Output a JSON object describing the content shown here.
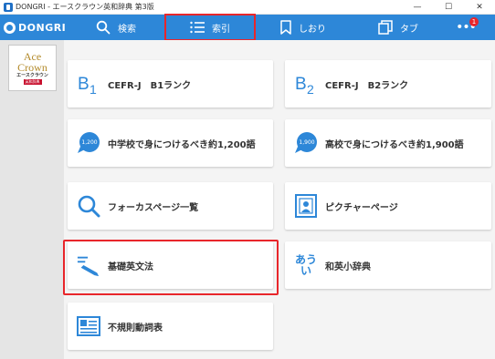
{
  "window": {
    "title": "DONGRI - エースクラウン英和辞典 第3版",
    "controls": [
      "—",
      "☐",
      "✕"
    ]
  },
  "toolbar": {
    "logo": "DONGRI",
    "tabs": [
      {
        "label": "検索",
        "icon": "search-icon"
      },
      {
        "label": "索引",
        "icon": "list-icon"
      },
      {
        "label": "しおり",
        "icon": "bookmark-icon"
      },
      {
        "label": "タブ",
        "icon": "tabs-icon"
      }
    ],
    "more_badge": "1",
    "accent_color": "#2d87d8",
    "highlight_color": "#e8262b"
  },
  "sidebar": {
    "book": {
      "line1": "Ace",
      "line2": "Crown",
      "line3": "エースクラウン",
      "line4": "英和辞典"
    }
  },
  "cards": [
    {
      "label": "CEFR-J　B1ランク",
      "icon": "b1-icon",
      "badge": "B1"
    },
    {
      "label": "CEFR-J　B2ランク",
      "icon": "b2-icon",
      "badge": "B2"
    },
    {
      "label": "中学校で身につけるべき約1,200語",
      "icon": "speech-bubble-icon",
      "badge": "1,200"
    },
    {
      "label": "高校で身につけるべき約1,900語",
      "icon": "speech-bubble-icon",
      "badge": "1,900"
    },
    {
      "label": "フォーカスページ一覧",
      "icon": "search-icon"
    },
    {
      "label": "ピクチャーページ",
      "icon": "picture-icon"
    },
    {
      "label": "基礎英文法",
      "icon": "pen-icon"
    },
    {
      "label": "和英小辞典",
      "icon": "aiu-icon",
      "badge_top": "あう",
      "badge_bottom": "い"
    },
    {
      "label": "不規則動詞表",
      "icon": "table-icon"
    }
  ]
}
